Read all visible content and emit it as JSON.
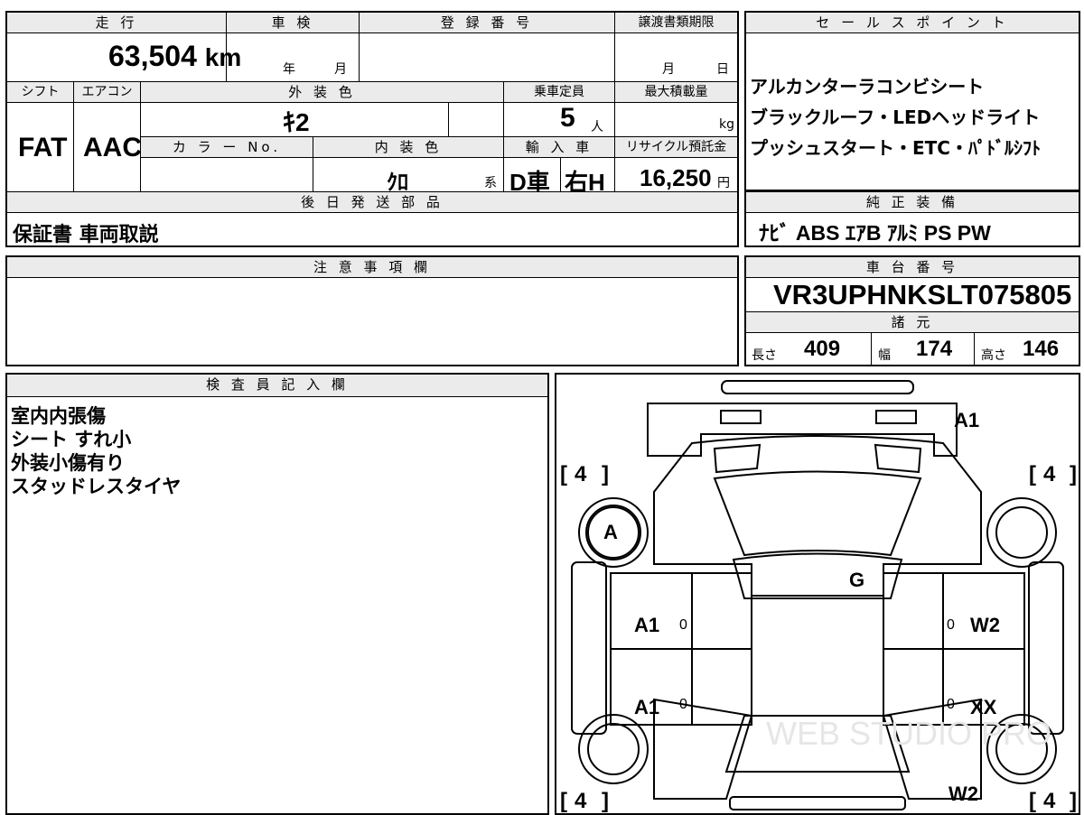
{
  "top_section": {
    "h_mileage": "走 行",
    "h_inspection": "車 検",
    "h_registration": "登 録 番 号",
    "h_transfer": "譲渡書類期限",
    "h_selling": "セ ー ル ス ポ イ ン ト",
    "mileage_value": "63,504",
    "mileage_unit": "km",
    "inspection_year": "年",
    "inspection_month": "月",
    "transfer_month": "月",
    "transfer_day": "日",
    "selling_points": [
      "アルカンターラコンビシート",
      "ブラックルーフ・LEDヘッドライト",
      "プッシュスタート・ETC・ﾊﾟﾄﾞﾙｼﾌﾄ"
    ]
  },
  "spec_section": {
    "h_shift": "シフト",
    "h_aircon": "エアコン",
    "h_exterior": "外 装 色",
    "h_capacity": "乗車定員",
    "h_max_load": "最大積載量",
    "shift": "FAT",
    "aircon": "AAC",
    "exterior_color": "ｷ2",
    "capacity": "5",
    "capacity_unit": "人",
    "max_load_unit": "kg",
    "h_color_no": "カ ラ ー No.",
    "h_interior": "内 装 色",
    "h_import": "輸 入 車",
    "h_recycle": "リサイクル預託金",
    "interior_color": "ｸﾛ",
    "interior_suffix": "系",
    "import_type": "D車",
    "handle": "右H",
    "recycle_fee": "16,250",
    "recycle_unit": "円"
  },
  "later_parts": {
    "header": "後 日 発 送 部 品",
    "value": "保証書 車両取説"
  },
  "genuine_equipment": {
    "header": "純 正 装 備",
    "value": "ﾅﾋﾞ ABS ｴｱB ｱﾙﾐ PS PW"
  },
  "notes": {
    "header": "注 意 事 項 欄",
    "value": ""
  },
  "chassis": {
    "header": "車 台 番 号",
    "value": "VR3UPHNKSLT075805",
    "spec_header": "諸 元",
    "length_label": "長さ",
    "length": "409",
    "width_label": "幅",
    "width": "174",
    "height_label": "高さ",
    "height": "146"
  },
  "inspector": {
    "header": "検 査 員 記 入 欄",
    "lines": [
      "室内内張傷",
      "シート すれ小",
      "外装小傷有り",
      "スタッドレスタイヤ"
    ]
  },
  "diagram": {
    "watermark": "WEB STUDIO PRO",
    "marks": {
      "front_right": "A1",
      "front_left_wheel": "A",
      "roof": "G",
      "left_front_door": "A1",
      "left_rear_door": "A1",
      "right_front_door": "W2",
      "right_rear_door": "XX",
      "rear_right": "W2"
    },
    "tire_front_left": "4",
    "tire_front_right": "4",
    "tire_rear_left": "4",
    "tire_rear_right": "4",
    "door_zero": "0"
  }
}
